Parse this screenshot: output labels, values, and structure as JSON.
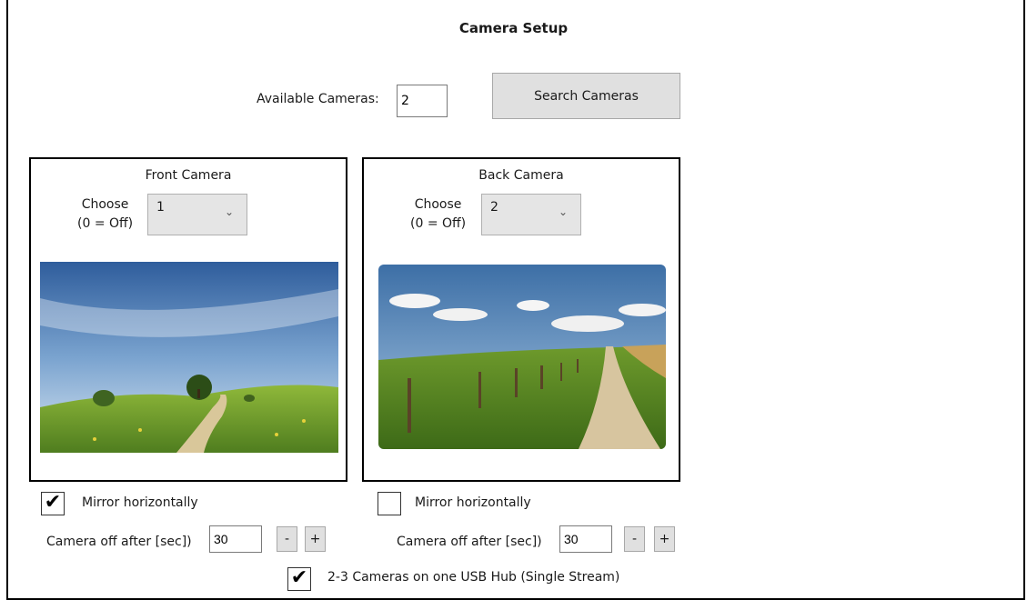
{
  "title": "Camera Setup",
  "available": {
    "label": "Available Cameras:",
    "value": "2"
  },
  "search_button": "Search Cameras",
  "front": {
    "title": "Front Camera",
    "choose_label_line1": "Choose",
    "choose_label_line2": "(0 = Off)",
    "selected": "1",
    "mirror_label": "Mirror horizontally",
    "mirror_checked": true,
    "off_label": "Camera off after [sec])",
    "off_value": "30",
    "minus": "-",
    "plus": "+"
  },
  "back": {
    "title": "Back Camera",
    "choose_label_line1": "Choose",
    "choose_label_line2": "(0 = Off)",
    "selected": "2",
    "mirror_label": "Mirror horizontally",
    "mirror_checked": false,
    "off_label": "Camera off after [sec])",
    "off_value": "30",
    "minus": "-",
    "plus": "+"
  },
  "usb_hub": {
    "label": "2-3 Cameras on one USB Hub (Single Stream)",
    "checked": true
  },
  "icons": {
    "check": "check-icon",
    "chevron": "chevron-down-icon"
  }
}
